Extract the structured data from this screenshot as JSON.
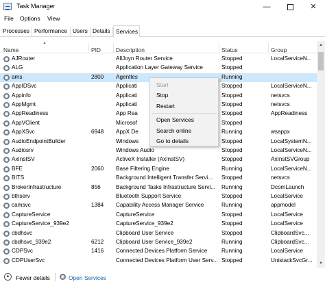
{
  "window": {
    "title": "Task Manager",
    "minimize": "—",
    "close": "✕"
  },
  "menu": [
    "File",
    "Options",
    "View"
  ],
  "tabs": [
    "Processes",
    "Performance",
    "Users",
    "Details",
    "Services"
  ],
  "active_tab": "Services",
  "columns": {
    "name": "Name",
    "pid": "PID",
    "description": "Description",
    "status": "Status",
    "group": "Group"
  },
  "rows": [
    {
      "name": "AJRouter",
      "pid": "",
      "description": "AllJoyn Router Service",
      "status": "Stopped",
      "group": "LocalServiceN..."
    },
    {
      "name": "ALG",
      "pid": "",
      "description": "Application Layer Gateway Service",
      "status": "Stopped",
      "group": ""
    },
    {
      "name": "ams",
      "pid": "2800",
      "description": "Agentles",
      "status": "Running",
      "group": ""
    },
    {
      "name": "AppIDSvc",
      "pid": "",
      "description": "Applicati",
      "status": "Stopped",
      "group": "LocalServiceN..."
    },
    {
      "name": "Appinfo",
      "pid": "",
      "description": "Applicati",
      "status": "Stopped",
      "group": "netsvcs"
    },
    {
      "name": "AppMgmt",
      "pid": "",
      "description": "Applicati",
      "status": "Stopped",
      "group": "netsvcs"
    },
    {
      "name": "AppReadiness",
      "pid": "",
      "description": "App Rea",
      "status": "Stopped",
      "group": "AppReadiness"
    },
    {
      "name": "AppVClient",
      "pid": "",
      "description": "Microsof",
      "status": "Stopped",
      "group": ""
    },
    {
      "name": "AppXSvc",
      "pid": "6948",
      "description": "AppX De",
      "status": "Running",
      "group": "wsappx"
    },
    {
      "name": "AudioEndpointBuilder",
      "pid": "",
      "description": "Windows",
      "status": "Stopped",
      "group": "LocalSystemN..."
    },
    {
      "name": "Audiosrv",
      "pid": "",
      "description": "Windows Audio",
      "status": "Stopped",
      "group": "LocalServiceN..."
    },
    {
      "name": "AxInstSV",
      "pid": "",
      "description": "ActiveX Installer (AxInstSV)",
      "status": "Stopped",
      "group": "AxInstSVGroup"
    },
    {
      "name": "BFE",
      "pid": "2060",
      "description": "Base Filtering Engine",
      "status": "Running",
      "group": "LocalServiceN..."
    },
    {
      "name": "BITS",
      "pid": "",
      "description": "Background Intelligent Transfer Servi...",
      "status": "Stopped",
      "group": "netsvcs"
    },
    {
      "name": "BrokerInfrastructure",
      "pid": "856",
      "description": "Background Tasks Infrastructure Servi...",
      "status": "Running",
      "group": "DcomLaunch"
    },
    {
      "name": "bthserv",
      "pid": "",
      "description": "Bluetooth Support Service",
      "status": "Stopped",
      "group": "LocalService"
    },
    {
      "name": "camsvc",
      "pid": "1384",
      "description": "Capability Access Manager Service",
      "status": "Running",
      "group": "appmodel"
    },
    {
      "name": "CaptureService",
      "pid": "",
      "description": "CaptureService",
      "status": "Stopped",
      "group": "LocalService"
    },
    {
      "name": "CaptureService_939e2",
      "pid": "",
      "description": "CaptureService_939e2",
      "status": "Stopped",
      "group": "LocalService"
    },
    {
      "name": "cbdhsvc",
      "pid": "",
      "description": "Clipboard User Service",
      "status": "Stopped",
      "group": "ClipboardSvc..."
    },
    {
      "name": "cbdhsvc_939e2",
      "pid": "6212",
      "description": "Clipboard User Service_939e2",
      "status": "Running",
      "group": "ClipboardSvc..."
    },
    {
      "name": "CDPSvc",
      "pid": "1416",
      "description": "Connected Devices Platform Service",
      "status": "Running",
      "group": "LocalService"
    },
    {
      "name": "CDPUserSvc",
      "pid": "",
      "description": "Connected Devices Platform User Serv...",
      "status": "Stopped",
      "group": "UnistackSvcGr..."
    }
  ],
  "context_menu": {
    "start": "Start",
    "stop": "Stop",
    "restart": "Restart",
    "open_services": "Open Services",
    "search_online": "Search online",
    "go_to_details": "Go to details"
  },
  "footer": {
    "fewer_details": "Fewer details",
    "open_services": "Open Services"
  },
  "colors": {
    "selected_row": "#cce8ff",
    "link": "#0066cc"
  }
}
